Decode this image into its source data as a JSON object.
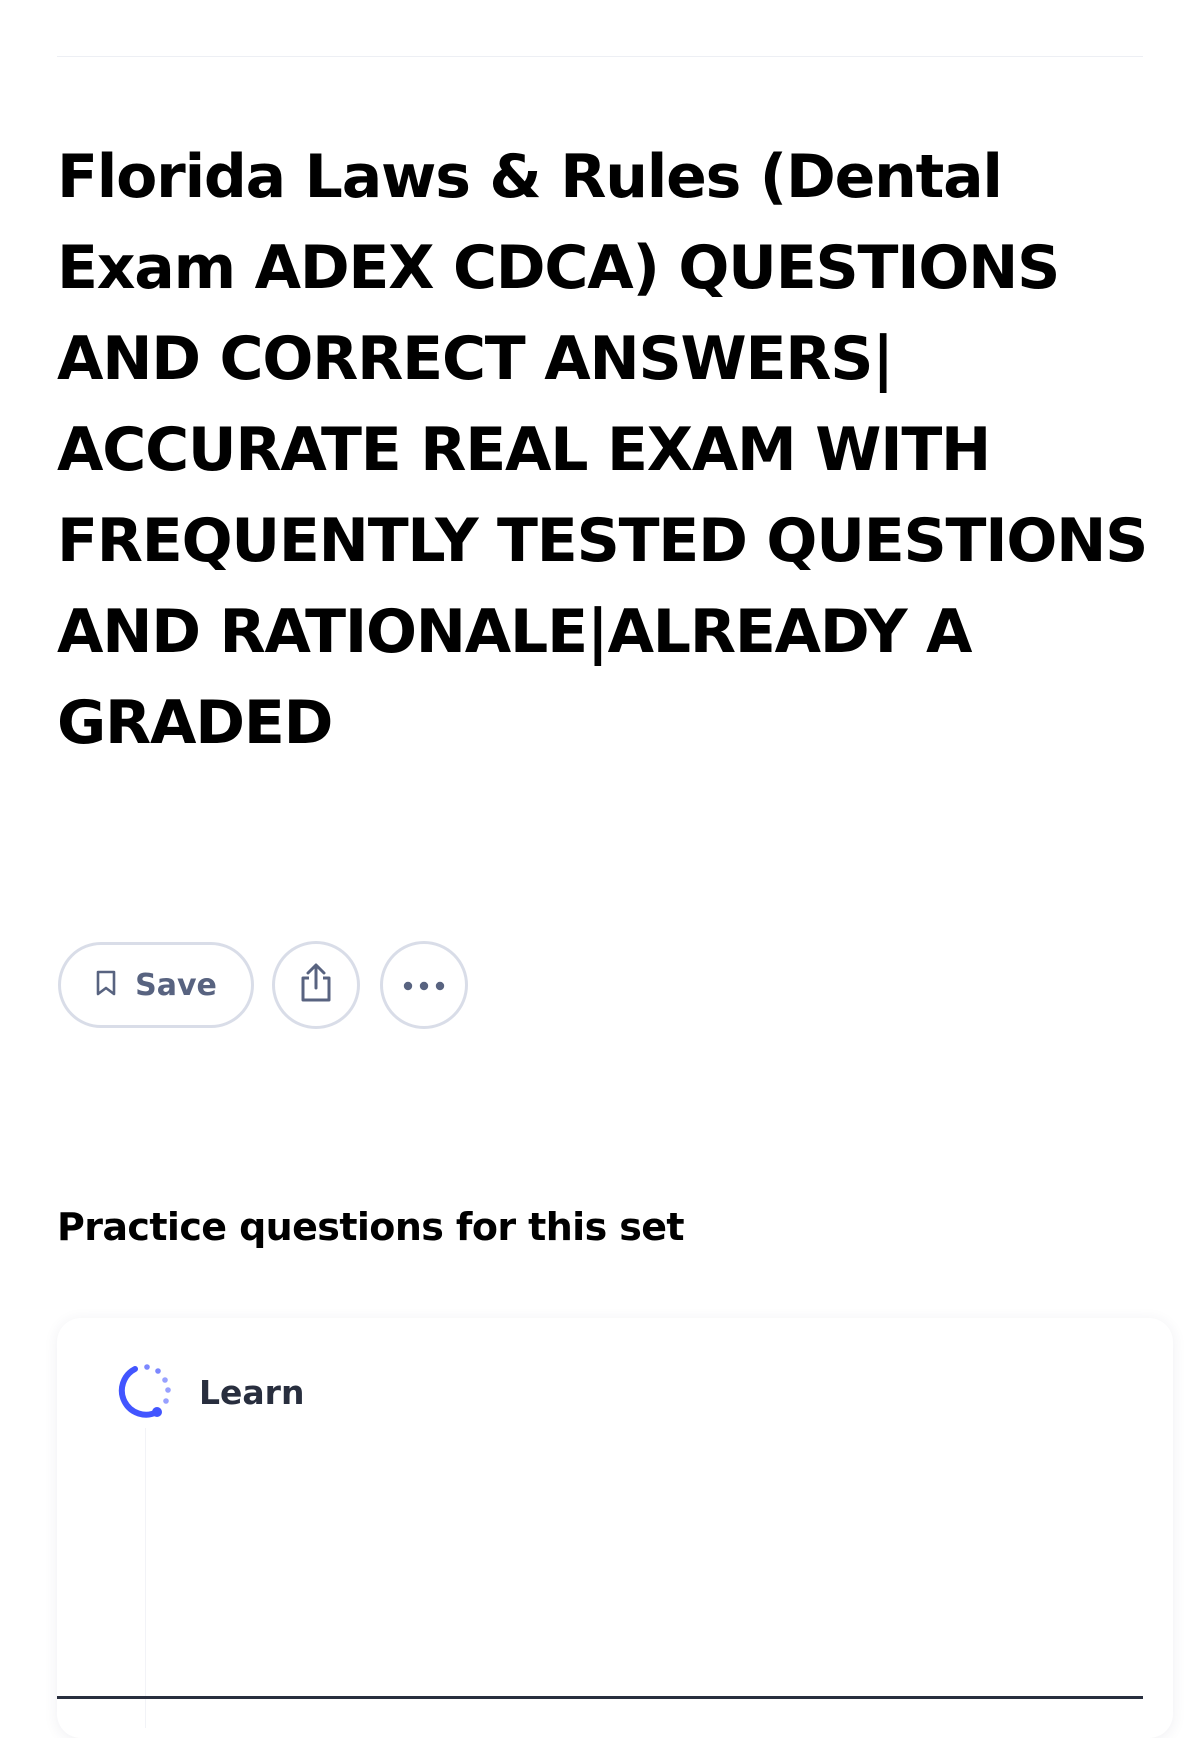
{
  "document": {
    "title": "Florida Laws & Rules (Dental Exam ADEX CDCA) QUESTIONS AND CORRECT ANSWERS| ACCURATE REAL EXAM WITH FREQUENTLY TESTED QUESTIONS AND RATIONALE|ALREADY A GRADED"
  },
  "actions": {
    "save_label": "Save",
    "save_icon": "bookmark-icon",
    "share_icon": "share-icon",
    "more_icon": "more-dots-icon"
  },
  "practice": {
    "heading": "Practice questions for this set",
    "items": [
      {
        "label": "Learn",
        "icon": "learn-progress-icon"
      }
    ]
  },
  "colors": {
    "title_text": "#000000",
    "button_border": "#d9dde8",
    "button_text": "#586380",
    "accent": "#4255ff"
  }
}
